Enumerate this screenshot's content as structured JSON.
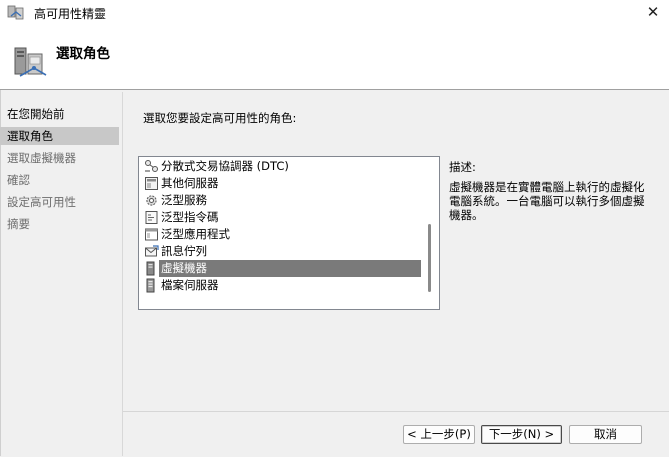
{
  "window": {
    "title": "高可用性精靈",
    "close_glyph": "✕"
  },
  "header": {
    "page_title": "選取角色"
  },
  "nav": {
    "items": [
      {
        "label": "在您開始前",
        "state": "normal"
      },
      {
        "label": "選取角色",
        "state": "selected"
      },
      {
        "label": "選取虛擬機器",
        "state": "disabled"
      },
      {
        "label": "確認",
        "state": "disabled"
      },
      {
        "label": "設定高可用性",
        "state": "disabled"
      },
      {
        "label": "摘要",
        "state": "disabled"
      }
    ]
  },
  "main": {
    "prompt": "選取您要設定高可用性的角色:",
    "roles": [
      {
        "label": "分散式交易協調器 (DTC)",
        "icon": "dtc-icon"
      },
      {
        "label": "其他伺服器",
        "icon": "server-icon"
      },
      {
        "label": "泛型服務",
        "icon": "gear-icon"
      },
      {
        "label": "泛型指令碼",
        "icon": "script-icon"
      },
      {
        "label": "泛型應用程式",
        "icon": "application-icon"
      },
      {
        "label": "訊息佇列",
        "icon": "message-queue-icon"
      },
      {
        "label": "虛擬機器",
        "icon": "virtual-machine-icon",
        "selected": true
      },
      {
        "label": "檔案伺服器",
        "icon": "file-server-icon"
      }
    ],
    "description_title": "描述:",
    "description_text": "虛擬機器是在實體電腦上執行的虛擬化電腦系統。一台電腦可以執行多個虛擬機器。"
  },
  "footer": {
    "back_label": "< 上一步(P)",
    "next_label": "下一步(N) >",
    "cancel_label": "取消"
  },
  "colors": {
    "selection": "#7a7a7a",
    "nav_selected": "#c8c8c8"
  }
}
